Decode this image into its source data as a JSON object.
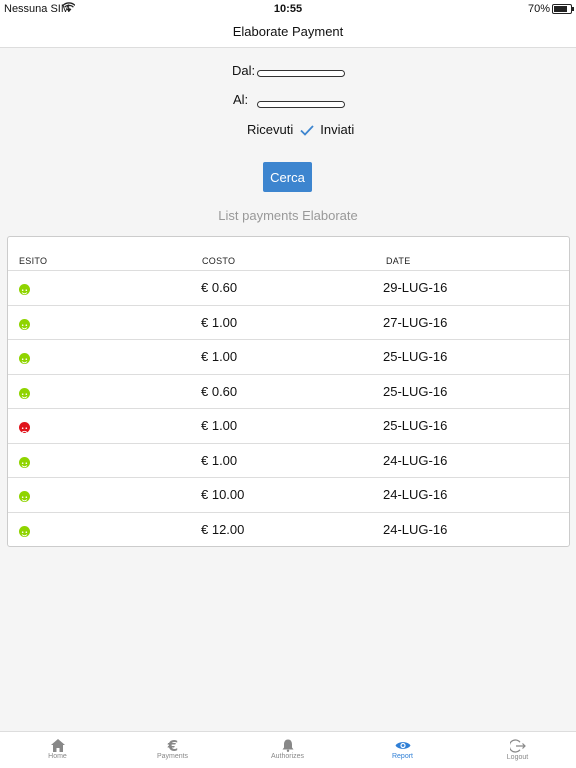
{
  "status_bar": {
    "carrier": "Nessuna SIM",
    "time": "10:55",
    "battery": "70%",
    "battery_level": 0.7
  },
  "header": {
    "title": "Elaborate Payment"
  },
  "filters": {
    "from_label": "Dal:",
    "to_label": "Al:",
    "from_value": "",
    "to_value": "",
    "received_label": "Ricevuti",
    "sent_label": "Inviati",
    "selected": "Inviati"
  },
  "search_button": {
    "label": "Cerca"
  },
  "list": {
    "title": "List payments Elaborate",
    "columns": [
      "ESITO",
      "COSTO",
      "DATE"
    ],
    "rows": [
      {
        "status": "ok",
        "cost": "€ 0.60",
        "date": "29-LUG-16"
      },
      {
        "status": "ok",
        "cost": "€ 1.00",
        "date": "27-LUG-16"
      },
      {
        "status": "ok",
        "cost": "€ 1.00",
        "date": "25-LUG-16"
      },
      {
        "status": "ok",
        "cost": "€ 0.60",
        "date": "25-LUG-16"
      },
      {
        "status": "ko",
        "cost": "€ 1.00",
        "date": "25-LUG-16"
      },
      {
        "status": "ok",
        "cost": "€ 1.00",
        "date": "24-LUG-16"
      },
      {
        "status": "ok",
        "cost": "€ 10.00",
        "date": "24-LUG-16"
      },
      {
        "status": "ok",
        "cost": "€ 12.00",
        "date": "24-LUG-16"
      }
    ]
  },
  "colors": {
    "accent": "#3d85cf",
    "ok": "#8fd400",
    "ko": "#e0141c",
    "tab_active": "#2f7fd6"
  },
  "tab_bar": {
    "items": [
      {
        "label": "Home",
        "icon": "home-icon"
      },
      {
        "label": "Payments",
        "icon": "euro-icon"
      },
      {
        "label": "Authorizes",
        "icon": "bell-icon"
      },
      {
        "label": "Report",
        "icon": "eye-icon",
        "active": true
      },
      {
        "label": "Logout",
        "icon": "logout-icon"
      }
    ]
  }
}
